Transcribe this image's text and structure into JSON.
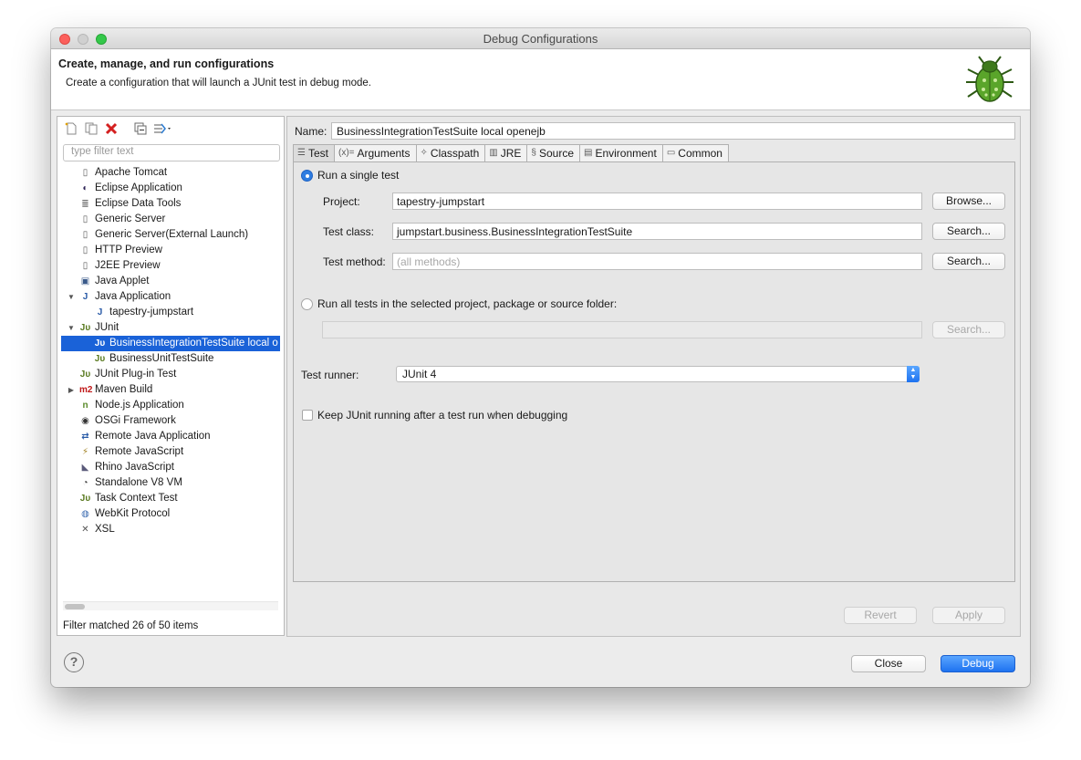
{
  "window": {
    "title": "Debug Configurations"
  },
  "header": {
    "title": "Create, manage, and run configurations",
    "description": "Create a configuration that will launch a JUnit test in debug mode."
  },
  "toolbar": {
    "icons": [
      "new-config-icon",
      "duplicate-icon",
      "delete-icon",
      "collapse-all-icon",
      "filter-icon"
    ]
  },
  "filter": {
    "placeholder": "type filter text"
  },
  "tree": [
    {
      "label": "Apache Tomcat",
      "icon": "server-icon",
      "depth": 0,
      "twisty": ""
    },
    {
      "label": "Eclipse Application",
      "icon": "eclipse-icon",
      "depth": 0,
      "twisty": ""
    },
    {
      "label": "Eclipse Data Tools",
      "icon": "database-icon",
      "depth": 0,
      "twisty": ""
    },
    {
      "label": "Generic Server",
      "icon": "server-icon",
      "depth": 0,
      "twisty": ""
    },
    {
      "label": "Generic Server(External Launch)",
      "icon": "server-icon",
      "depth": 0,
      "twisty": ""
    },
    {
      "label": "HTTP Preview",
      "icon": "server-icon",
      "depth": 0,
      "twisty": ""
    },
    {
      "label": "J2EE Preview",
      "icon": "server-icon",
      "depth": 0,
      "twisty": ""
    },
    {
      "label": "Java Applet",
      "icon": "applet-icon",
      "depth": 0,
      "twisty": ""
    },
    {
      "label": "Java Application",
      "icon": "java-app-icon",
      "depth": 0,
      "twisty": "open"
    },
    {
      "label": "tapestry-jumpstart",
      "icon": "java-app-icon",
      "depth": 1,
      "twisty": ""
    },
    {
      "label": "JUnit",
      "icon": "junit-icon",
      "depth": 0,
      "twisty": "open"
    },
    {
      "label": "BusinessIntegrationTestSuite local o",
      "icon": "junit-icon",
      "depth": 1,
      "twisty": "",
      "selected": true
    },
    {
      "label": "BusinessUnitTestSuite",
      "icon": "junit-icon",
      "depth": 1,
      "twisty": ""
    },
    {
      "label": "JUnit Plug-in Test",
      "icon": "junit-icon",
      "depth": 0,
      "twisty": ""
    },
    {
      "label": "Maven Build",
      "icon": "maven-icon",
      "depth": 0,
      "twisty": "closed"
    },
    {
      "label": "Node.js Application",
      "icon": "nodejs-icon",
      "depth": 0,
      "twisty": ""
    },
    {
      "label": "OSGi Framework",
      "icon": "osgi-icon",
      "depth": 0,
      "twisty": ""
    },
    {
      "label": "Remote Java Application",
      "icon": "remote-java-icon",
      "depth": 0,
      "twisty": ""
    },
    {
      "label": "Remote JavaScript",
      "icon": "remote-js-icon",
      "depth": 0,
      "twisty": ""
    },
    {
      "label": "Rhino JavaScript",
      "icon": "rhino-icon",
      "depth": 0,
      "twisty": ""
    },
    {
      "label": "Standalone V8 VM",
      "icon": "v8-icon",
      "depth": 0,
      "twisty": ""
    },
    {
      "label": "Task Context Test",
      "icon": "junit-icon",
      "depth": 0,
      "twisty": ""
    },
    {
      "label": "WebKit Protocol",
      "icon": "webkit-icon",
      "depth": 0,
      "twisty": ""
    },
    {
      "label": "XSL",
      "icon": "xsl-icon",
      "depth": 0,
      "twisty": ""
    }
  ],
  "status": "Filter matched 26 of 50 items",
  "name_label": "Name:",
  "name_value": "BusinessIntegrationTestSuite local openejb",
  "tabs": [
    {
      "label": "Test",
      "icon": "test-tab-icon"
    },
    {
      "label": "Arguments",
      "icon": "arguments-icon"
    },
    {
      "label": "Classpath",
      "icon": "classpath-icon"
    },
    {
      "label": "JRE",
      "icon": "jre-icon"
    },
    {
      "label": "Source",
      "icon": "source-icon"
    },
    {
      "label": "Environment",
      "icon": "environment-icon"
    },
    {
      "label": "Common",
      "icon": "common-icon"
    }
  ],
  "test": {
    "single_label": "Run a single test",
    "project_label": "Project:",
    "project_value": "tapestry-jumpstart",
    "browse": "Browse...",
    "class_label": "Test class:",
    "class_value": "jumpstart.business.BusinessIntegrationTestSuite",
    "search": "Search...",
    "method_label": "Test method:",
    "method_placeholder": "(all methods)",
    "all_label": "Run all tests in the selected project, package or source folder:",
    "runner_label": "Test runner:",
    "runner_value": "JUnit 4",
    "keep_label": "Keep JUnit running after a test run when debugging"
  },
  "buttons": {
    "revert": "Revert",
    "apply": "Apply",
    "close": "Close",
    "debug": "Debug",
    "help": "?"
  }
}
